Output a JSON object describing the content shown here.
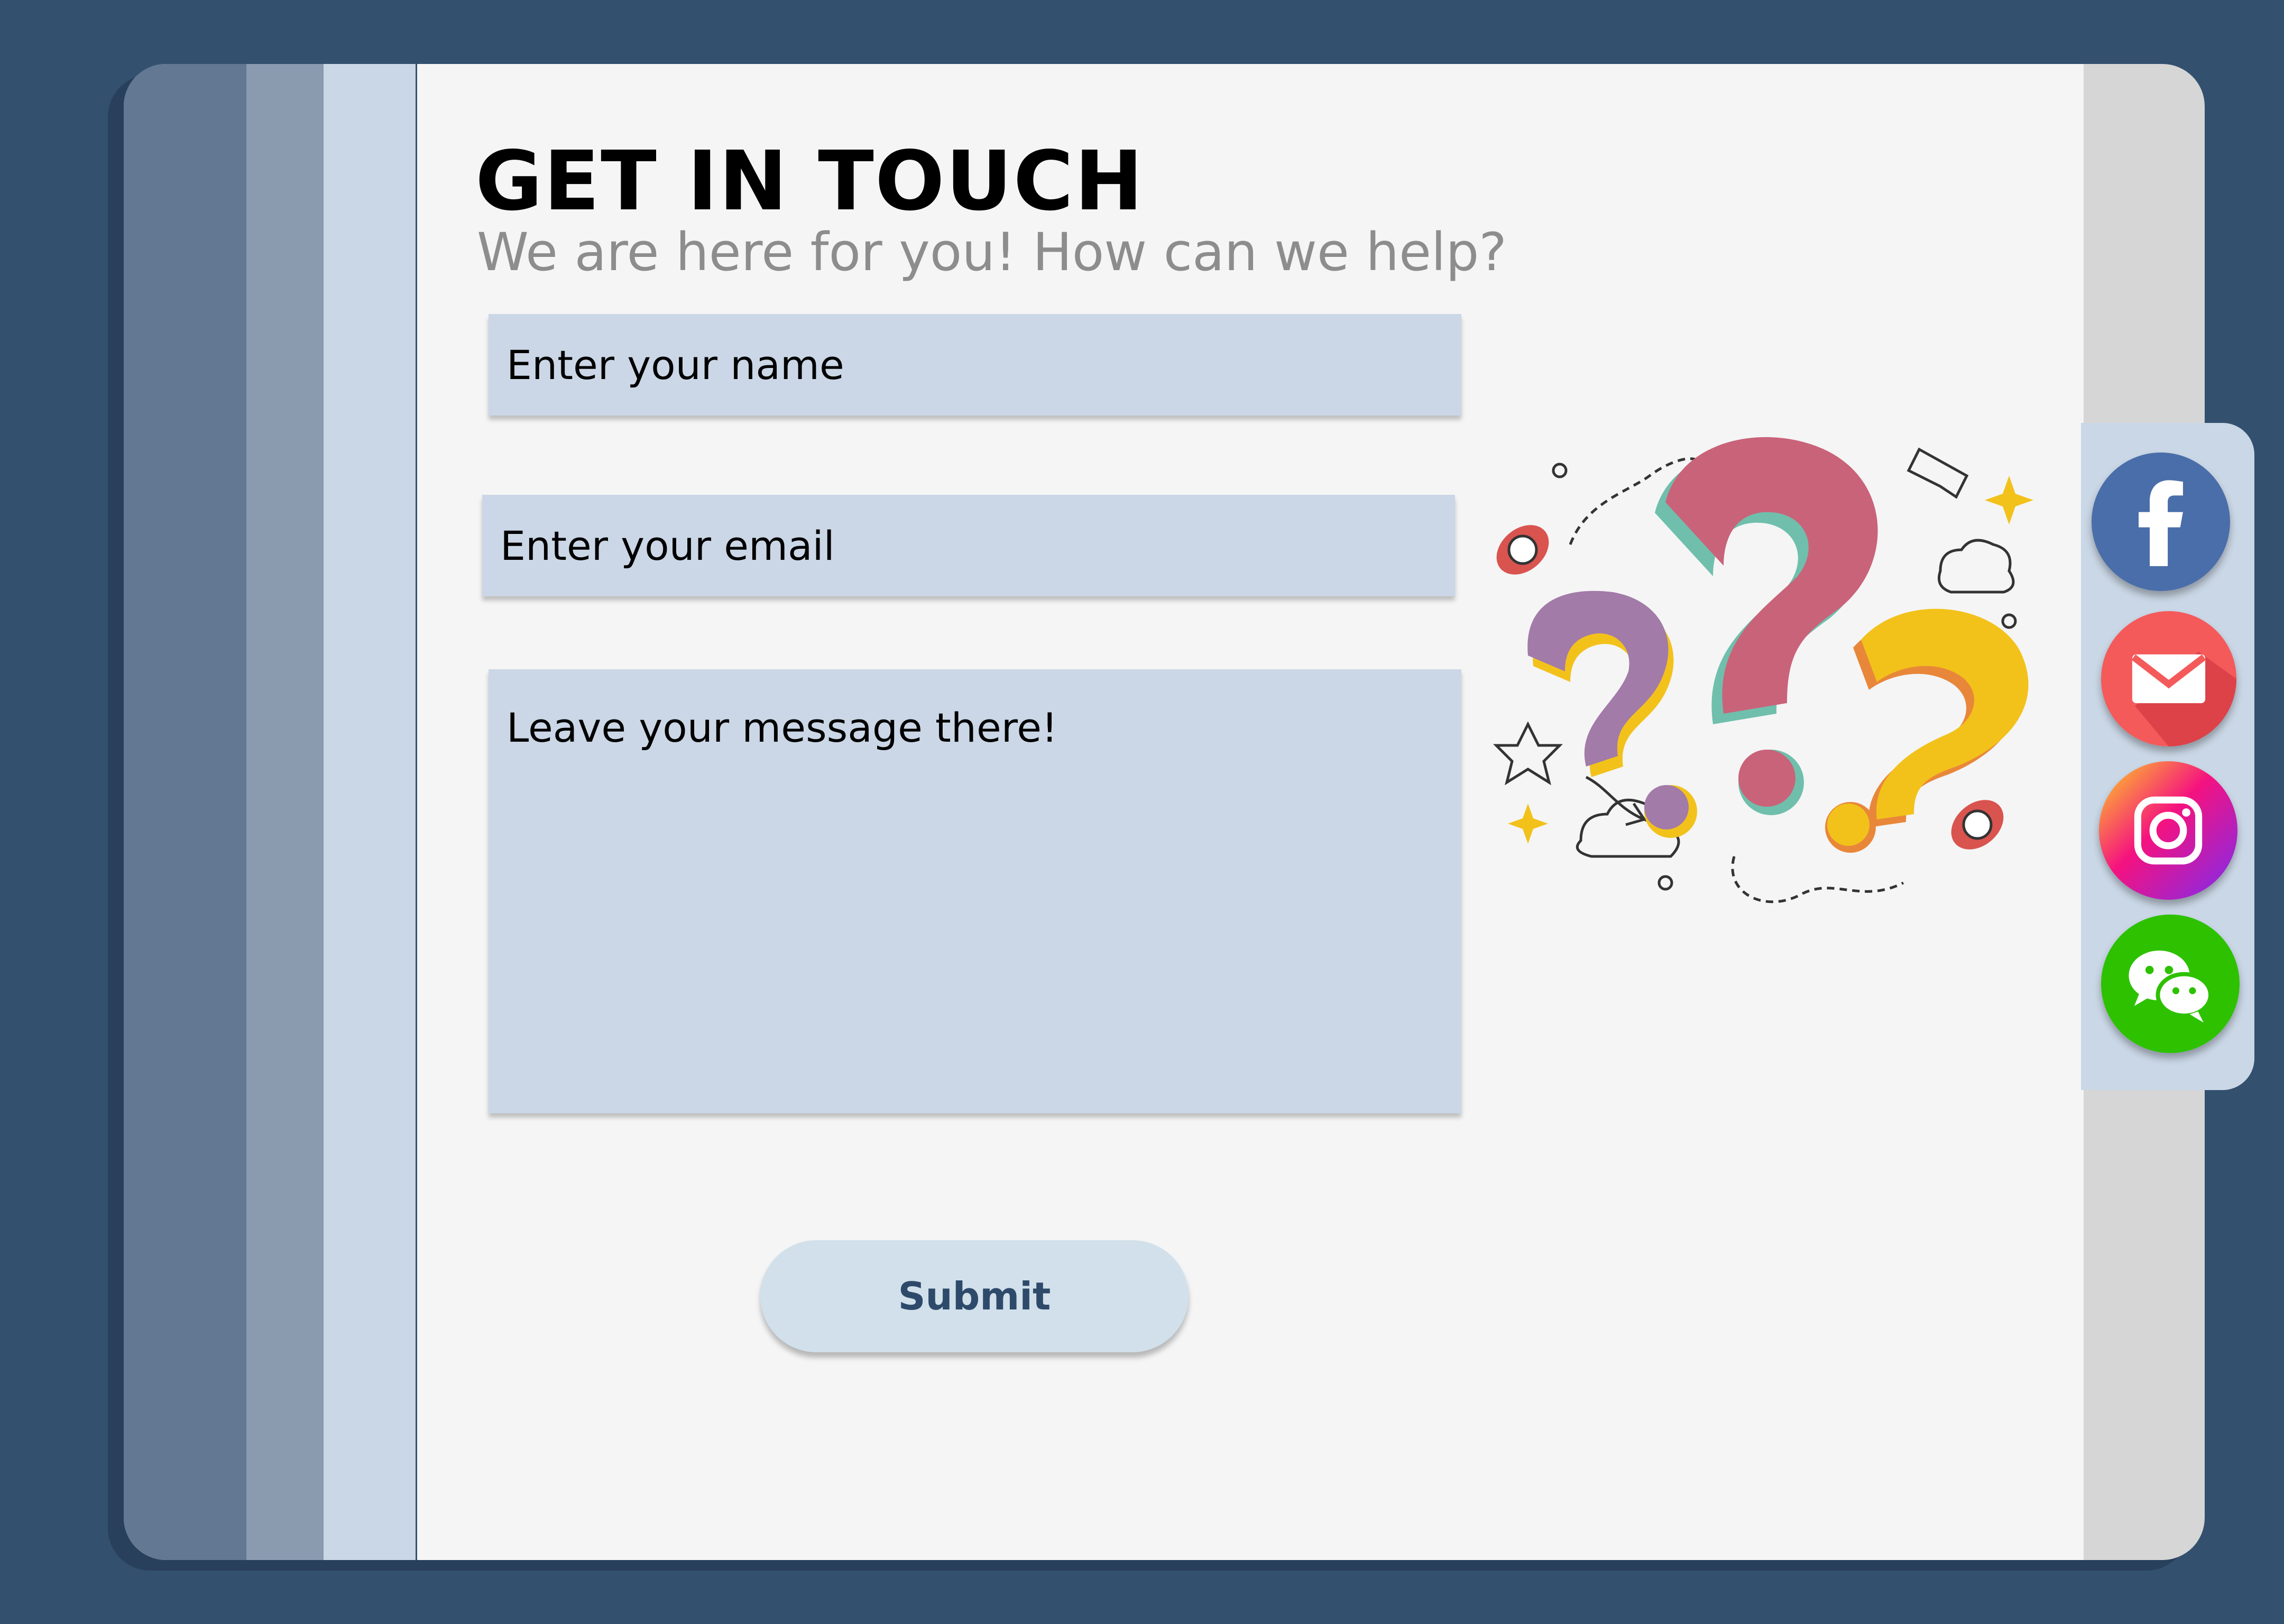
{
  "header": {
    "title": "GET IN TOUCH",
    "subtitle": "We are here for you! How can we help?"
  },
  "form": {
    "name_placeholder": "Enter your name",
    "email_placeholder": "Enter your email",
    "message_placeholder": "Leave your message there!",
    "submit_label": "Submit"
  },
  "social": [
    {
      "icon": "facebook-icon",
      "color": "#4a6ea9"
    },
    {
      "icon": "email-icon",
      "color": "#f45a5a"
    },
    {
      "icon": "instagram-icon",
      "color": "#d62976"
    },
    {
      "icon": "wechat-icon",
      "color": "#2dc100"
    }
  ],
  "colors": {
    "background": "#33506f",
    "panel": "#f5f5f5",
    "field": "#cbd7e6",
    "button": "#d1e0ea",
    "button_text": "#2e4a6b"
  }
}
